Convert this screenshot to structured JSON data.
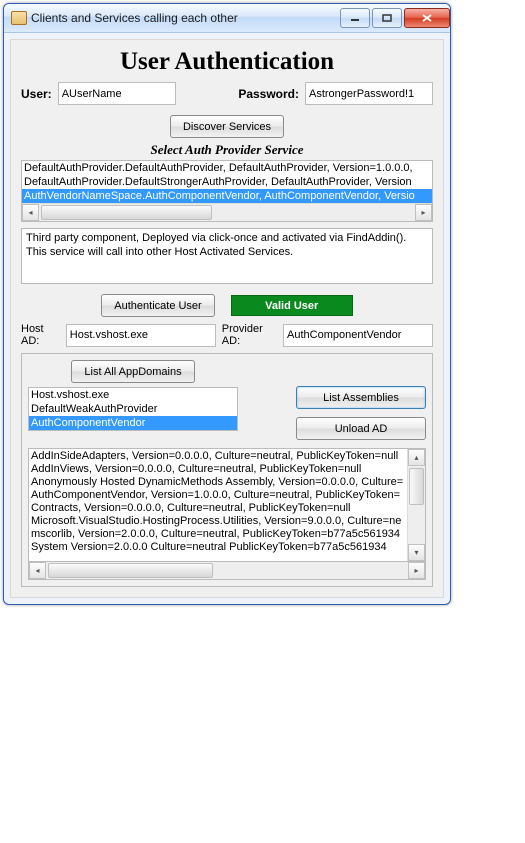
{
  "window": {
    "title": "Clients and Services calling each other"
  },
  "header": {
    "main_title": "User Authentication"
  },
  "credentials": {
    "user_label": "User:",
    "user_value": "AUserName",
    "password_label": "Password:",
    "password_value": "AstrongerPassword!1"
  },
  "discover": {
    "button_label": "Discover Services",
    "section_label": "Select Auth Provider Service"
  },
  "provider_list": {
    "items": [
      "DefaultAuthProvider.DefaultAuthProvider, DefaultAuthProvider, Version=1.0.0.0,",
      "DefaultAuthProvider.DefaultStrongerAuthProvider, DefaultAuthProvider, Version",
      "AuthVendorNameSpace.AuthComponentVendor, AuthComponentVendor, Versio"
    ],
    "selected_index": 2
  },
  "description": "Third party component, Deployed via click-once and activated via FindAddin(). This service will call into other Host Activated Services.",
  "auth": {
    "button_label": "Authenticate User",
    "status_text": "Valid User"
  },
  "ad_info": {
    "host_label": "Host AD:",
    "host_value": "Host.vshost.exe",
    "provider_label": "Provider AD:",
    "provider_value": "AuthComponentVendor"
  },
  "appdomains": {
    "list_button": "List All AppDomains",
    "items": [
      "Host.vshost.exe",
      "DefaultWeakAuthProvider",
      "AuthComponentVendor"
    ],
    "selected_index": 2,
    "list_assemblies_button": "List Assemblies",
    "unload_button": "Unload AD"
  },
  "assemblies": {
    "lines": [
      "AddInSideAdapters, Version=0.0.0.0, Culture=neutral, PublicKeyToken=null",
      "AddInViews, Version=0.0.0.0, Culture=neutral, PublicKeyToken=null",
      "Anonymously Hosted DynamicMethods Assembly, Version=0.0.0.0, Culture=",
      "AuthComponentVendor, Version=1.0.0.0, Culture=neutral, PublicKeyToken=",
      "Contracts, Version=0.0.0.0, Culture=neutral, PublicKeyToken=null",
      "Microsoft.VisualStudio.HostingProcess.Utilities, Version=9.0.0.0, Culture=ne",
      "mscorlib, Version=2.0.0.0, Culture=neutral, PublicKeyToken=b77a5c561934",
      "System  Version=2.0.0.0  Culture=neutral  PublicKeyToken=b77a5c561934"
    ]
  }
}
